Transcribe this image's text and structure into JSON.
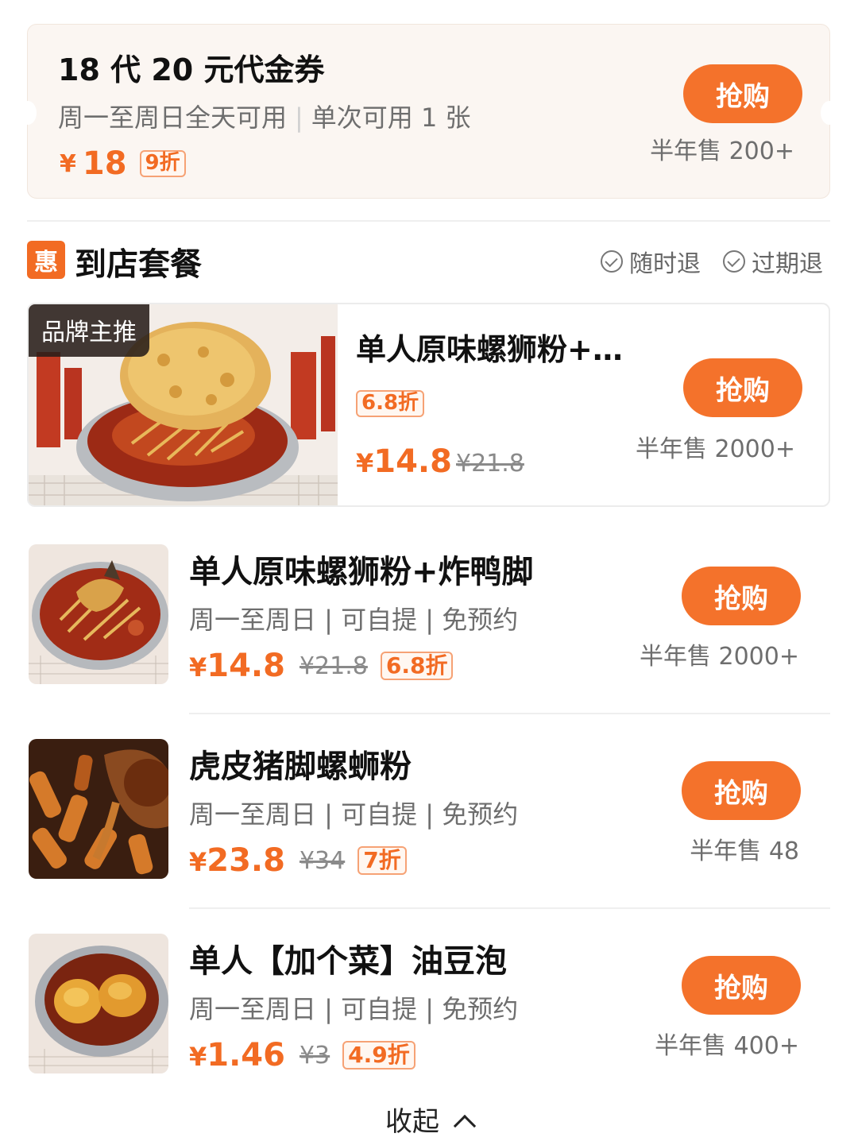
{
  "voucher": {
    "title": "18 代 20 元代金券",
    "cond1": "周一至周日全天可用",
    "cond2": "单次可用 1 张",
    "currency": "¥",
    "price": "18",
    "discount": "9折",
    "buy_label": "抢购",
    "sales": "半年售 200+"
  },
  "section": {
    "icon_text": "惠",
    "title": "到店套餐",
    "policy1": "随时退",
    "policy2": "过期退"
  },
  "featured": {
    "tag": "品牌主推",
    "name": "单人原味螺狮粉+…",
    "discount": "6.8折",
    "currency": "¥",
    "price": "14.8",
    "orig_price": "¥21.8",
    "buy_label": "抢购",
    "sales": "半年售 2000+"
  },
  "items": [
    {
      "name": "单人原味螺狮粉+炸鸭脚",
      "tags": "周一至周日 | 可自提 | 免预约",
      "currency": "¥",
      "price": "14.8",
      "orig_price": "¥21.8",
      "discount": "6.8折",
      "buy_label": "抢购",
      "sales": "半年售 2000+"
    },
    {
      "name": "虎皮猪脚螺蛳粉",
      "tags": "周一至周日 | 可自提 | 免预约",
      "currency": "¥",
      "price": "23.8",
      "orig_price": "¥34",
      "discount": "7折",
      "buy_label": "抢购",
      "sales": "半年售 48"
    },
    {
      "name": "单人【加个菜】油豆泡",
      "tags": "周一至周日 | 可自提 | 免预约",
      "currency": "¥",
      "price": "1.46",
      "orig_price": "¥3",
      "discount": "4.9折",
      "buy_label": "抢购",
      "sales": "半年售 400+"
    }
  ],
  "collapse_label": "收起",
  "colors": {
    "accent": "#f26b23",
    "button": "#f4722b",
    "voucher_bg": "#fbf6f2"
  }
}
